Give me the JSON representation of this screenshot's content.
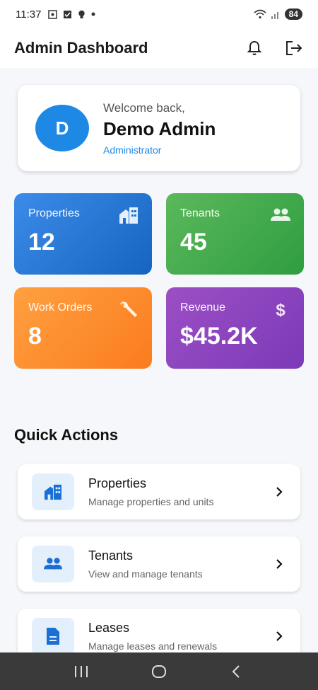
{
  "status_bar": {
    "time": "11:37",
    "battery": "84"
  },
  "app_bar": {
    "title": "Admin Dashboard",
    "icons": [
      "bell-icon",
      "logout-icon"
    ]
  },
  "welcome": {
    "greeting": "Welcome back,",
    "name": "Demo Admin",
    "role": "Administrator",
    "avatar_letter": "D"
  },
  "stats": [
    {
      "label": "Properties",
      "value": "12",
      "icon": "building-icon"
    },
    {
      "label": "Tenants",
      "value": "45",
      "icon": "people-icon"
    },
    {
      "label": "Work Orders",
      "value": "8",
      "icon": "wrench-icon"
    },
    {
      "label": "Revenue",
      "value": "$45.2K",
      "icon": "dollar-icon"
    }
  ],
  "quick_actions": {
    "title": "Quick Actions",
    "items": [
      {
        "title": "Properties",
        "subtitle": "Manage properties and units",
        "icon": "building-icon"
      },
      {
        "title": "Tenants",
        "subtitle": "View and manage tenants",
        "icon": "people-icon"
      },
      {
        "title": "Leases",
        "subtitle": "Manage leases and renewals",
        "icon": "document-icon"
      }
    ]
  },
  "colors": {
    "primary": "#1e88e5",
    "properties": "#1e78e0",
    "tenants": "#43a84a",
    "work_orders": "#fd8c2c",
    "revenue": "#8a44bd"
  }
}
